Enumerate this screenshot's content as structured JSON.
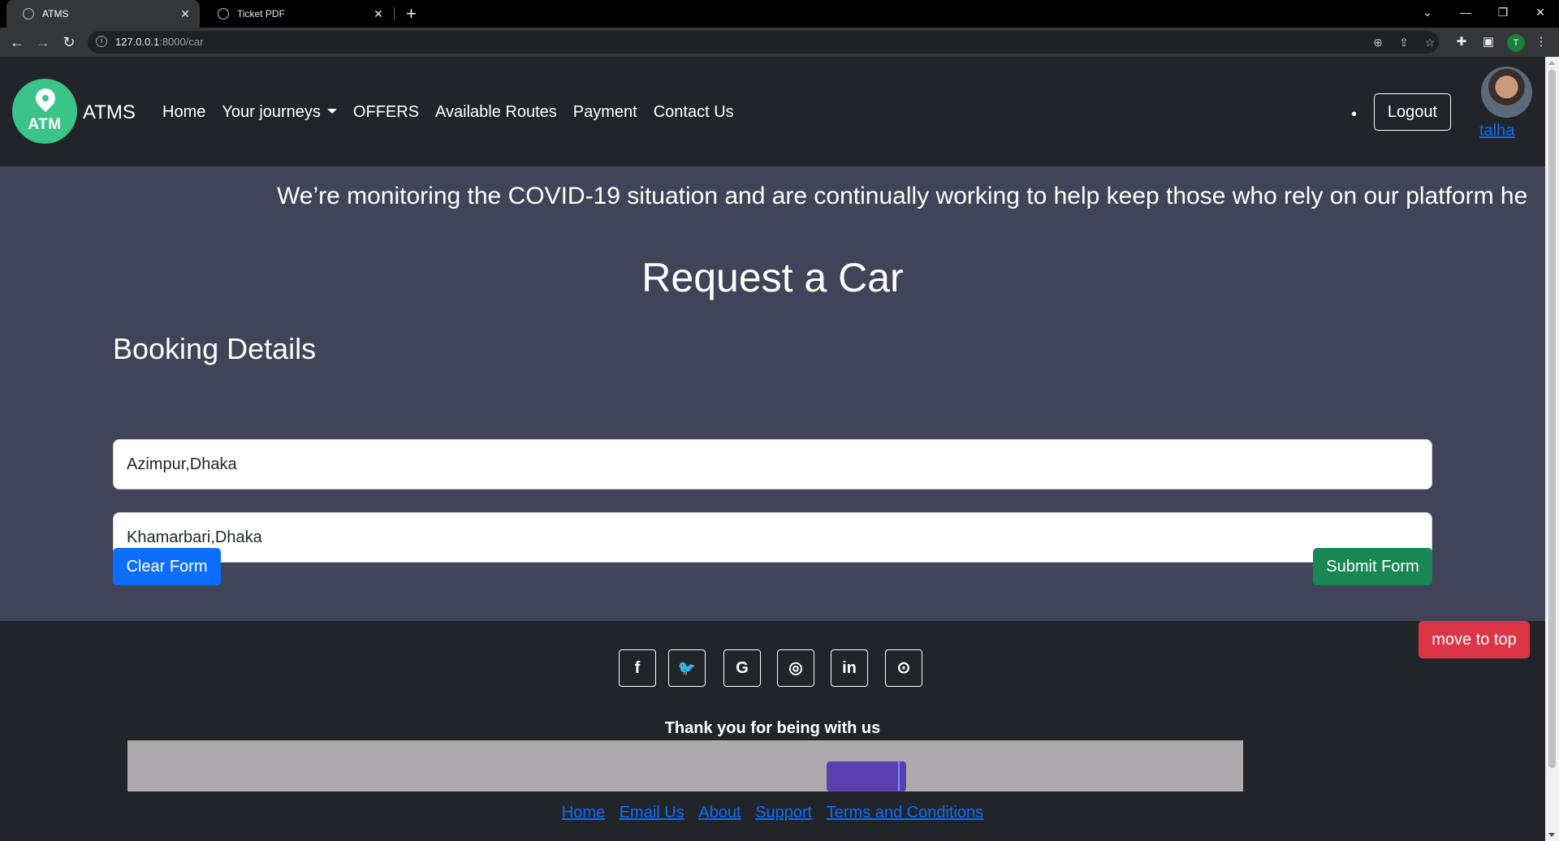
{
  "browser": {
    "tabs": [
      {
        "title": "ATMS",
        "active": true
      },
      {
        "title": "Ticket PDF",
        "active": false
      }
    ],
    "url_host": "127.0.0.1",
    "url_rest": ":8000/car",
    "profile_initial": "T"
  },
  "navbar": {
    "logo_text": "ATM",
    "brand": "ATMS",
    "links": [
      "Home",
      "Your journeys",
      "OFFERS",
      "Available Routes",
      "Payment",
      "Contact Us"
    ],
    "dot": "•",
    "logout": "Logout",
    "username": "talha"
  },
  "main": {
    "marquee": "We’re monitoring the COVID-19 situation and are continually working to help keep those who rely on our platform he",
    "title": "Request a Car",
    "subtitle": "Booking Details",
    "fields": {
      "pickup": "Azimpur,Dhaka",
      "destination": "Khamarbari,Dhaka"
    },
    "clear_button": "Clear Form",
    "submit_button": "Submit Form"
  },
  "footer": {
    "social_icons": [
      "facebook-icon",
      "twitter-icon",
      "google-icon",
      "instagram-icon",
      "linkedin-icon",
      "github-icon"
    ],
    "social_glyphs": [
      "f",
      "🐦",
      "G",
      "◎",
      "in",
      "⊙"
    ],
    "thanks": "Thank you for being with us",
    "links": [
      "Home",
      "Email Us",
      "About",
      "Support",
      "Terms and Conditions"
    ],
    "move_to_top": "move to top"
  },
  "colors": {
    "primary": "#0d6efd",
    "success": "#198754",
    "danger": "#dc3545",
    "logo": "#3ac48a",
    "main_bg": "#414459",
    "dark_bg": "#212529"
  }
}
